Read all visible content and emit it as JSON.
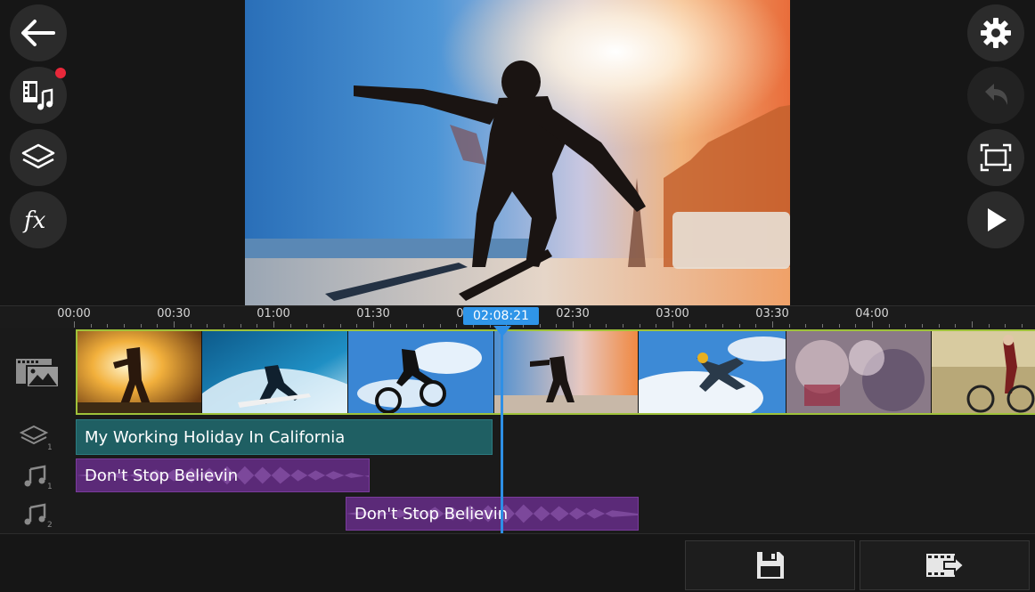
{
  "ruler": {
    "labels": [
      "00:00",
      "00:30",
      "01:00",
      "01:30",
      "02:00",
      "02:30",
      "03:00",
      "03:30",
      "04:00"
    ]
  },
  "playhead": {
    "time": "02:08:21"
  },
  "tracks": {
    "text_layer": {
      "title": "My Working Holiday In California",
      "index": "1"
    },
    "audio_1": {
      "title": "Don't Stop Believin",
      "index": "1"
    },
    "audio_2": {
      "title": "Don't Stop Believin",
      "index": "2"
    }
  },
  "colors": {
    "accent_blue": "#2f95e8",
    "video_track_border": "#9fc23a",
    "text_layer_bg": "#1f5f63",
    "audio_bg": "#5b2a78",
    "notification_dot": "#e8283a"
  },
  "icons": {
    "left": [
      "back-arrow-icon",
      "media-library-icon",
      "layers-icon",
      "fx-icon"
    ],
    "right": [
      "gear-icon",
      "undo-icon",
      "fullscreen-icon",
      "play-icon"
    ],
    "bottom": [
      "save-icon",
      "export-video-icon"
    ]
  }
}
